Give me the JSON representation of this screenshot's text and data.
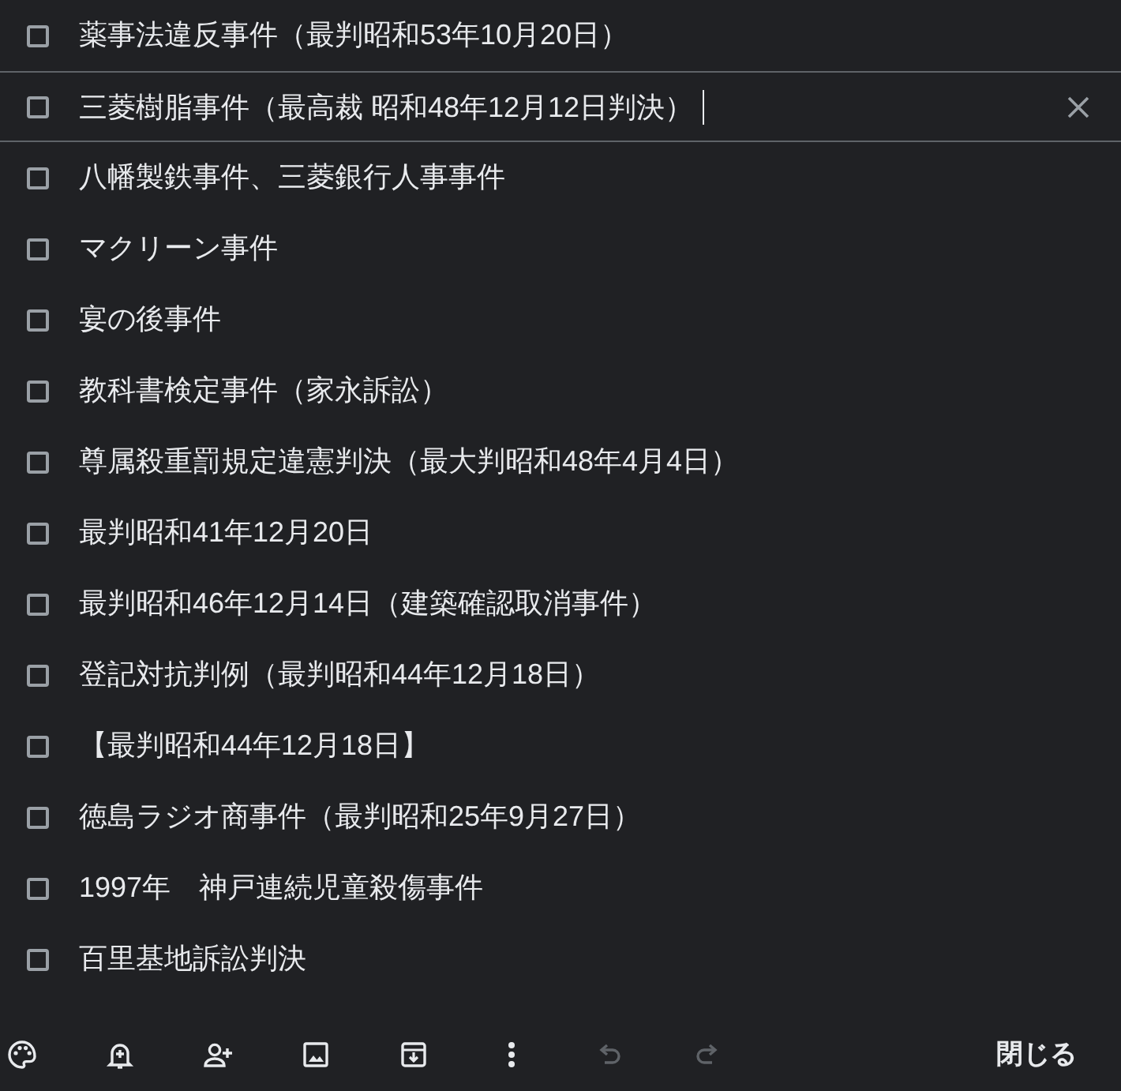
{
  "items": [
    {
      "text": "薬事法違反事件（最判昭和53年10月20日）",
      "checked": false,
      "focused": false
    },
    {
      "text": "三菱樹脂事件（最高裁 昭和48年12月12日判決）",
      "checked": false,
      "focused": true
    },
    {
      "text": "八幡製鉄事件、三菱銀行人事事件",
      "checked": false,
      "focused": false
    },
    {
      "text": "マクリーン事件",
      "checked": false,
      "focused": false
    },
    {
      "text": "宴の後事件",
      "checked": false,
      "focused": false
    },
    {
      "text": "教科書検定事件（家永訴訟）",
      "checked": false,
      "focused": false
    },
    {
      "text": "尊属殺重罰規定違憲判決（最大判昭和48年4月4日）",
      "checked": false,
      "focused": false
    },
    {
      "text": "最判昭和41年12月20日",
      "checked": false,
      "focused": false
    },
    {
      "text": "最判昭和46年12月14日（建築確認取消事件）",
      "checked": false,
      "focused": false
    },
    {
      "text": "登記対抗判例（最判昭和44年12月18日）",
      "checked": false,
      "focused": false
    },
    {
      "text": "【最判昭和44年12月18日】",
      "checked": false,
      "focused": false
    },
    {
      "text": "徳島ラジオ商事件（最判昭和25年9月27日）",
      "checked": false,
      "focused": false
    },
    {
      "text": "1997年　神戸連続児童殺傷事件",
      "checked": false,
      "focused": false
    },
    {
      "text": "百里基地訴訟判決",
      "checked": false,
      "focused": false
    }
  ],
  "toolbar": [
    {
      "kind": "palette",
      "disabled": false
    },
    {
      "kind": "reminder",
      "disabled": false
    },
    {
      "kind": "collaborator",
      "disabled": false
    },
    {
      "kind": "image",
      "disabled": false
    },
    {
      "kind": "archive",
      "disabled": false
    },
    {
      "kind": "more",
      "disabled": false
    },
    {
      "kind": "undo",
      "disabled": true
    },
    {
      "kind": "redo",
      "disabled": true
    }
  ],
  "close_button": "閉じる"
}
